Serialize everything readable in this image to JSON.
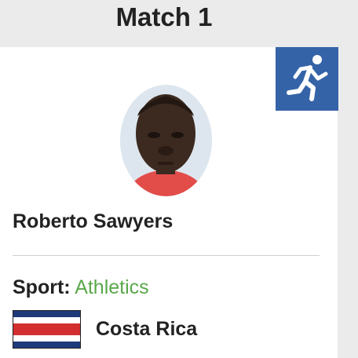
{
  "header": {
    "title": "Match 1"
  },
  "sport_badge": {
    "icon": "running-icon",
    "color": "#3563a8"
  },
  "athlete": {
    "name": "Roberto Sawyers",
    "sport_label": "Sport:",
    "sport_value": "Athletics",
    "country": "Costa Rica"
  },
  "flag": {
    "icon": "costa-rica-flag",
    "colors": {
      "blue": "#1f3a7a",
      "white": "#ffffff",
      "red": "#d32f2f"
    }
  },
  "colors": {
    "accent_green": "#5aa84a",
    "background": "#ebebeb"
  }
}
